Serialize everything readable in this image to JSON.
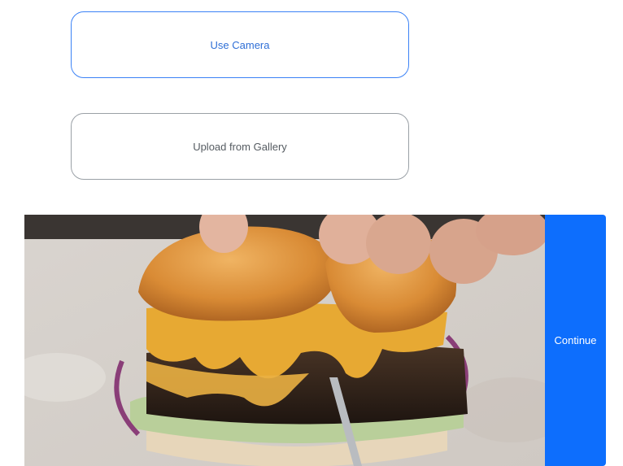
{
  "options": {
    "camera_label": "Use Camera",
    "gallery_label": "Upload from Gallery"
  },
  "preview": {
    "image_subject": "burger-photo"
  },
  "actions": {
    "continue_label": "Continue"
  },
  "colors": {
    "accent": "#0d6efd",
    "camera_border": "#3b82f6",
    "gallery_border": "#9aa0a6"
  }
}
